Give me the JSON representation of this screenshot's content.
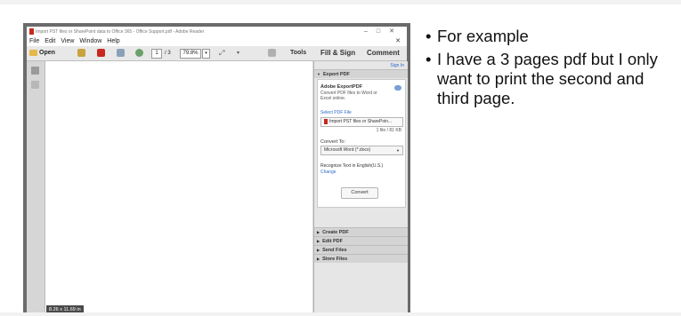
{
  "slide": {
    "bullets": [
      "For example",
      "I have a 3 pages pdf but I only want to print the second and third page."
    ]
  },
  "window": {
    "title": "Import PST files or SharePoint data to Office 365 - Office Support.pdf - Adobe Reader",
    "controls": [
      "–",
      "□",
      "✕"
    ],
    "system_label": "Sign in"
  },
  "menu": {
    "items": [
      "File",
      "Edit",
      "View",
      "Window",
      "Help"
    ],
    "close": "✕"
  },
  "toolbar": {
    "open_label": "Open",
    "page_current": "1",
    "page_total": "/ 3",
    "zoom": "79.8%",
    "tools_label": "Tools",
    "fill_sign_label": "Fill & Sign",
    "comment_label": "Comment"
  },
  "document": {
    "page_size": "8.26 x 11.69 in"
  },
  "panel": {
    "sign_in": "Sign In",
    "export_header": "Export PDF",
    "export_title": "Adobe ExportPDF",
    "export_desc": "Convert PDF files to Word or Excel online.",
    "select_label": "Select PDF File",
    "file_name": "Import PST files or SharePoin...",
    "file_size": "1 file / 81 KB",
    "convert_to_label": "Convert To:",
    "format": "Microsoft Word (*.docx)",
    "recognize_text": "Recognize Text in English(U.S.)",
    "change_link": "Change",
    "convert_button": "Convert",
    "sections": [
      "Create PDF",
      "Edit PDF",
      "Send Files",
      "Store Files"
    ]
  },
  "colors": {
    "pdf_red": "#c8281e",
    "link_blue": "#2a6ac8",
    "panel_bg": "#e6e6e6"
  }
}
